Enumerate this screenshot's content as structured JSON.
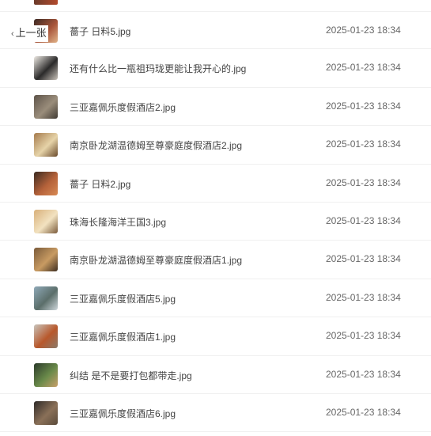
{
  "nav": {
    "prev_label": "上一张"
  },
  "files": [
    {
      "name": "薔子 日料5.jpg",
      "date": "2025-01-23 18:34",
      "thumb": [
        "#3b2a24",
        "#a8553a",
        "#e2b48a"
      ]
    },
    {
      "name": "还有什么比一瓶祖玛珑更能让我开心的.jpg",
      "date": "2025-01-23 18:34",
      "thumb": [
        "#f0ece6",
        "#2b2a2a",
        "#c9c3ba"
      ]
    },
    {
      "name": "三亚嘉佩乐度假酒店2.jpg",
      "date": "2025-01-23 18:34",
      "thumb": [
        "#5d5349",
        "#9a8d7b",
        "#403a33"
      ]
    },
    {
      "name": "南京卧龙湖温德姆至尊豪庭度假酒店2.jpg",
      "date": "2025-01-23 18:34",
      "thumb": [
        "#a57a4c",
        "#e6d3a8",
        "#6a4a2c"
      ]
    },
    {
      "name": "薔子 日料2.jpg",
      "date": "2025-01-23 18:34",
      "thumb": [
        "#3a2a20",
        "#b5623a",
        "#d88a54"
      ]
    },
    {
      "name": "珠海长隆海洋王国3.jpg",
      "date": "2025-01-23 18:34",
      "thumb": [
        "#d8b07a",
        "#f2e2c0",
        "#7a5a3a"
      ]
    },
    {
      "name": "南京卧龙湖温德姆至尊豪庭度假酒店1.jpg",
      "date": "2025-01-23 18:34",
      "thumb": [
        "#7a5a3a",
        "#c89b62",
        "#3e2e20"
      ]
    },
    {
      "name": "三亚嘉佩乐度假酒店5.jpg",
      "date": "2025-01-23 18:34",
      "thumb": [
        "#8fa9b8",
        "#5b6e6a",
        "#cfd8dc"
      ]
    },
    {
      "name": "三亚嘉佩乐度假酒店1.jpg",
      "date": "2025-01-23 18:34",
      "thumb": [
        "#c8c4bc",
        "#b8582c",
        "#8a7a6a"
      ]
    },
    {
      "name": "纠结 是不是要打包都带走.jpg",
      "date": "2025-01-23 18:34",
      "thumb": [
        "#2b3a2a",
        "#6a8a4a",
        "#c8a06a"
      ]
    },
    {
      "name": "三亚嘉佩乐度假酒店6.jpg",
      "date": "2025-01-23 18:34",
      "thumb": [
        "#2e2a28",
        "#8a7058",
        "#5a4a3a"
      ]
    }
  ]
}
